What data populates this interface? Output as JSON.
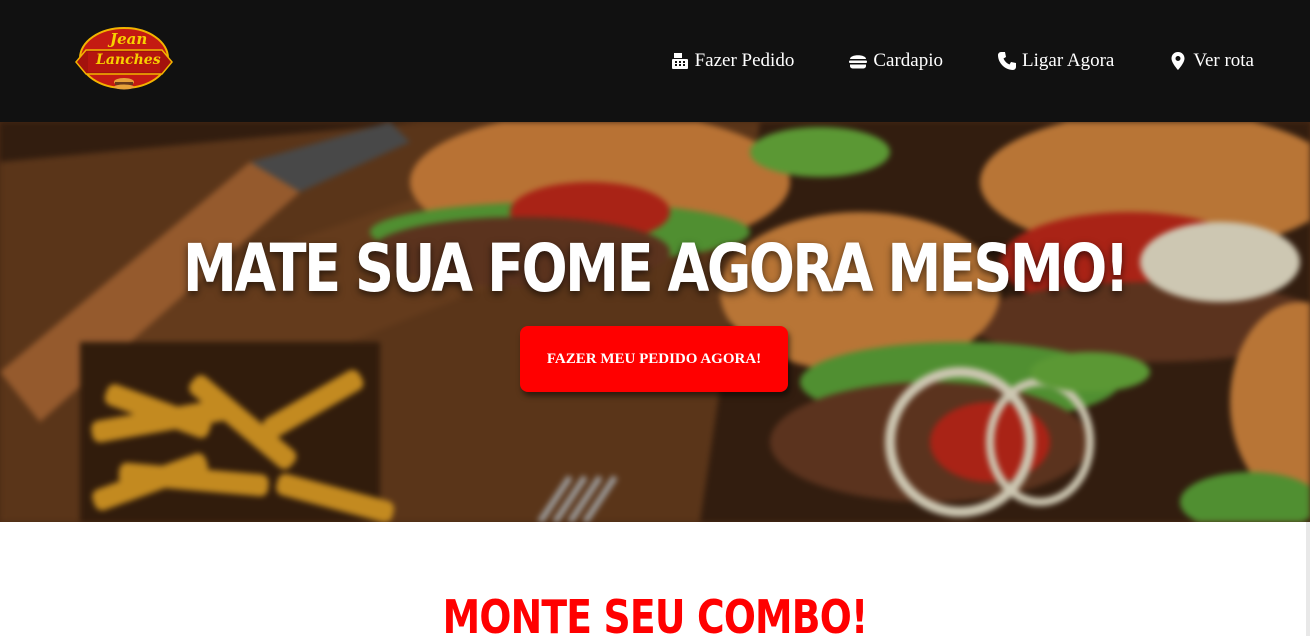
{
  "header": {
    "logo": {
      "line1": "Jean",
      "line2": "Lanches"
    },
    "nav": [
      {
        "label": "Fazer Pedido",
        "icon": "cash-register-icon"
      },
      {
        "label": "Cardapio",
        "icon": "hamburger-icon"
      },
      {
        "label": "Ligar Agora",
        "icon": "phone-icon"
      },
      {
        "label": "Ver rota",
        "icon": "map-pin-icon"
      }
    ]
  },
  "hero": {
    "title": "MATE SUA FOME AGORA MESMO!",
    "button_label": "FAZER MEU PEDIDO AGORA!"
  },
  "combo": {
    "title": "MONTE SEU COMBO!"
  },
  "colors": {
    "header_bg": "#111111",
    "accent": "#ff0000",
    "text_light": "#ffffff"
  }
}
